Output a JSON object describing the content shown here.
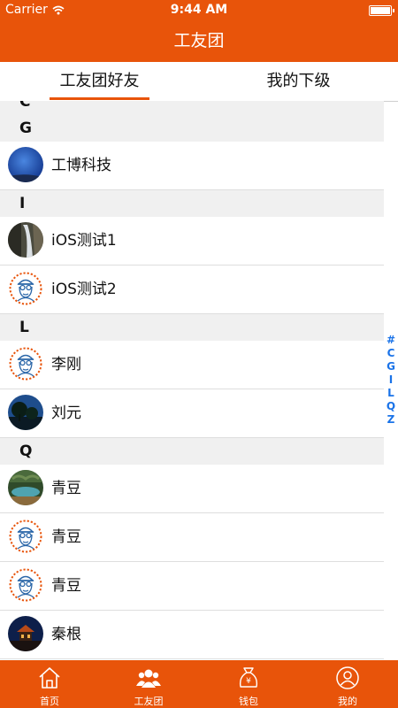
{
  "status_bar": {
    "carrier": "Carrier",
    "time": "9:44 AM"
  },
  "nav": {
    "title": "工友团"
  },
  "tabs": [
    {
      "label": "工友团好友",
      "selected": true
    },
    {
      "label": "我的下级",
      "selected": false
    }
  ],
  "colors": {
    "accent": "#e8540a",
    "index": "#1a73e8"
  },
  "sections": [
    {
      "letter": "C",
      "rows": []
    },
    {
      "letter": "G",
      "rows": [
        {
          "name": "工博科技",
          "avatar": "sky-photo"
        }
      ]
    },
    {
      "letter": "I",
      "rows": [
        {
          "name": "iOS测试1",
          "avatar": "waterfall-photo"
        },
        {
          "name": "iOS测试2",
          "avatar": "default-worker-avatar"
        }
      ]
    },
    {
      "letter": "L",
      "rows": [
        {
          "name": "李刚",
          "avatar": "default-worker-avatar"
        },
        {
          "name": "刘元",
          "avatar": "night-tree-photo"
        }
      ]
    },
    {
      "letter": "Q",
      "rows": [
        {
          "name": "青豆",
          "avatar": "lake-photo"
        },
        {
          "name": "青豆",
          "avatar": "default-worker-avatar"
        },
        {
          "name": "青豆",
          "avatar": "default-worker-avatar"
        },
        {
          "name": "秦根",
          "avatar": "temple-night-photo"
        }
      ]
    }
  ],
  "index_letters": [
    "#",
    "C",
    "G",
    "I",
    "L",
    "Q",
    "Z"
  ],
  "tabbar": [
    {
      "label": "首页",
      "icon": "home-icon",
      "selected": false
    },
    {
      "label": "工友团",
      "icon": "group-icon",
      "selected": true
    },
    {
      "label": "钱包",
      "icon": "wallet-icon",
      "selected": false
    },
    {
      "label": "我的",
      "icon": "profile-icon",
      "selected": false
    }
  ]
}
